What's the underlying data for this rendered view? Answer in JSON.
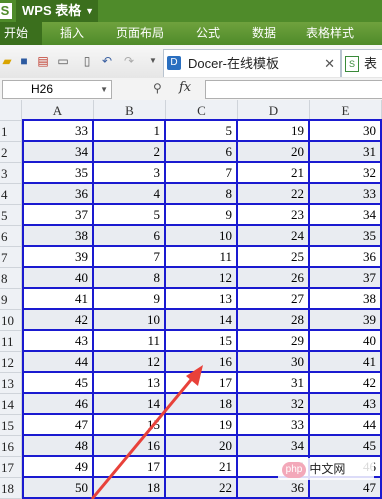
{
  "app": {
    "logo": "S",
    "title": "WPS 表格"
  },
  "menu": {
    "items": [
      "开始",
      "插入",
      "页面布局",
      "公式",
      "数据",
      "表格样式"
    ],
    "active": 0
  },
  "toolbar": {
    "icons": [
      "folder-open-icon",
      "save-icon",
      "pdf-icon",
      "print-icon",
      "print-preview-icon",
      "undo-icon",
      "redo-icon",
      "dropdown-icon"
    ],
    "tabs": [
      {
        "label": "Docer-在线模板"
      },
      {
        "label": "表格"
      }
    ]
  },
  "formula_bar": {
    "cell_ref": "H26",
    "fx": "fx",
    "value": ""
  },
  "columns": [
    "A",
    "B",
    "C",
    "D",
    "E"
  ],
  "rows": [
    {
      "n": "1",
      "cells": [
        "33",
        "1",
        "5",
        "19",
        "30"
      ]
    },
    {
      "n": "2",
      "cells": [
        "34",
        "2",
        "6",
        "20",
        "31"
      ]
    },
    {
      "n": "3",
      "cells": [
        "35",
        "3",
        "7",
        "21",
        "32"
      ]
    },
    {
      "n": "4",
      "cells": [
        "36",
        "4",
        "8",
        "22",
        "33"
      ]
    },
    {
      "n": "5",
      "cells": [
        "37",
        "5",
        "9",
        "23",
        "34"
      ]
    },
    {
      "n": "6",
      "cells": [
        "38",
        "6",
        "10",
        "24",
        "35"
      ]
    },
    {
      "n": "7",
      "cells": [
        "39",
        "7",
        "11",
        "25",
        "36"
      ]
    },
    {
      "n": "8",
      "cells": [
        "40",
        "8",
        "12",
        "26",
        "37"
      ]
    },
    {
      "n": "9",
      "cells": [
        "41",
        "9",
        "13",
        "27",
        "38"
      ]
    },
    {
      "n": "10",
      "cells": [
        "42",
        "10",
        "14",
        "28",
        "39"
      ]
    },
    {
      "n": "11",
      "cells": [
        "43",
        "11",
        "15",
        "29",
        "40"
      ]
    },
    {
      "n": "12",
      "cells": [
        "44",
        "12",
        "16",
        "30",
        "41"
      ]
    },
    {
      "n": "13",
      "cells": [
        "45",
        "13",
        "17",
        "31",
        "42"
      ]
    },
    {
      "n": "14",
      "cells": [
        "46",
        "14",
        "18",
        "32",
        "43"
      ]
    },
    {
      "n": "15",
      "cells": [
        "47",
        "15",
        "19",
        "33",
        "44"
      ]
    },
    {
      "n": "16",
      "cells": [
        "48",
        "16",
        "20",
        "34",
        "45"
      ]
    },
    {
      "n": "17",
      "cells": [
        "49",
        "17",
        "21",
        "35",
        "46"
      ]
    },
    {
      "n": "18",
      "cells": [
        "50",
        "18",
        "22",
        "36",
        "47"
      ]
    }
  ],
  "colors": {
    "brand_green": "#4f8b2a",
    "cell_border": "#1a1ad0",
    "arrow": "#e8413a"
  },
  "watermark": {
    "logo": "php",
    "text": "中文网"
  }
}
